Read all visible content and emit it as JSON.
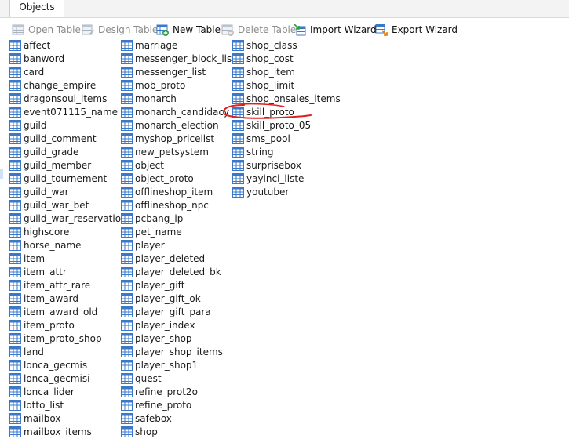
{
  "tabs": [
    {
      "label": "Objects"
    }
  ],
  "toolbar": {
    "open_table": "Open Table",
    "design_table": "Design Table",
    "new_table": "New Table",
    "delete_table": "Delete Table",
    "import_wizard": "Import Wizard",
    "export_wizard": "Export Wizard"
  },
  "columns": [
    [
      "affect",
      "banword",
      "card",
      "change_empire",
      "dragonsoul_items",
      "event071115_name",
      "guild",
      "guild_comment",
      "guild_grade",
      "guild_member",
      "guild_tournement",
      "guild_war",
      "guild_war_bet",
      "guild_war_reservation",
      "highscore",
      "horse_name",
      "item",
      "item_attr",
      "item_attr_rare",
      "item_award",
      "item_award_old",
      "item_proto",
      "item_proto_shop",
      "land",
      "lonca_gecmis",
      "lonca_gecmisi",
      "lonca_lider",
      "lotto_list",
      "mailbox",
      "mailbox_items"
    ],
    [
      "marriage",
      "messenger_block_list",
      "messenger_list",
      "mob_proto",
      "monarch",
      "monarch_candidacy",
      "monarch_election",
      "myshop_pricelist",
      "new_petsystem",
      "object",
      "object_proto",
      "offlineshop_item",
      "offlineshop_npc",
      "pcbang_ip",
      "pet_name",
      "player",
      "player_deleted",
      "player_deleted_bk",
      "player_gift",
      "player_gift_ok",
      "player_gift_para",
      "player_index",
      "player_shop",
      "player_shop_items",
      "player_shop1",
      "quest",
      "refine_prot2o",
      "refine_proto",
      "safebox",
      "shop"
    ],
    [
      "shop_class",
      "shop_cost",
      "shop_item",
      "shop_limit",
      "shop_onsales_items",
      "skill_proto",
      "skill_proto_05",
      "sms_pool",
      "string",
      "surprisebox",
      "yayinci_liste",
      "youtuber"
    ]
  ],
  "colors": {
    "table_icon_blue": "#3a78c9",
    "highlight_scribble": "#e02020"
  }
}
